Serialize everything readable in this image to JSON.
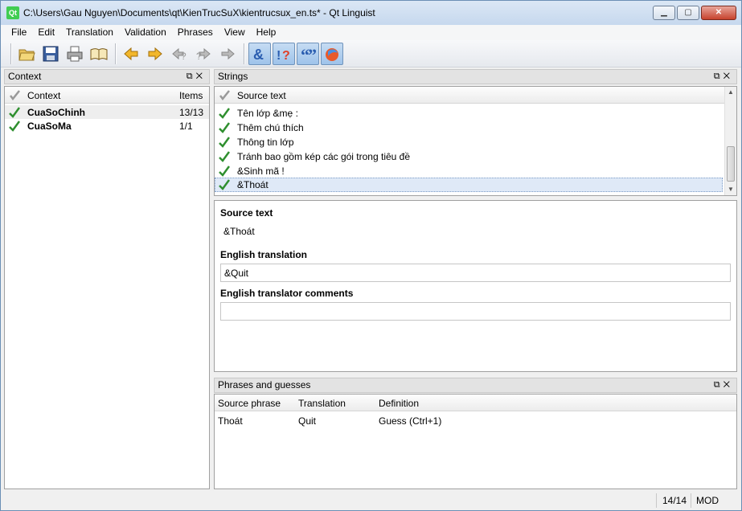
{
  "window": {
    "title": "C:\\Users\\Gau Nguyen\\Documents\\qt\\KienTrucSuX\\kientrucsux_en.ts* - Qt Linguist",
    "app_icon": "Qt"
  },
  "menu": [
    "File",
    "Edit",
    "Translation",
    "Validation",
    "Phrases",
    "View",
    "Help"
  ],
  "toolbar": {
    "icons": [
      "open-icon",
      "save-icon",
      "print-icon",
      "phrasebook-icon",
      "prev-icon",
      "next-icon",
      "prev-unfinished-icon",
      "next-unfinished-icon",
      "done-next-icon",
      "accelerators-icon",
      "punctuation-icon",
      "phrase-matches-icon",
      "placeholder-icon"
    ]
  },
  "context_dock": {
    "title": "Context",
    "columns": {
      "context": "Context",
      "items": "Items"
    },
    "rows": [
      {
        "name": "CuaSoChinh",
        "items": "13/13"
      },
      {
        "name": "CuaSoMa",
        "items": "1/1"
      }
    ]
  },
  "strings_dock": {
    "title": "Strings",
    "column": "Source text",
    "rows": [
      {
        "text": "Tên lớp &mẹ :"
      },
      {
        "text": "Thêm chú thích"
      },
      {
        "text": "Thông tin lớp"
      },
      {
        "text": "Tránh bao gồm kép các gói trong tiêu đề"
      },
      {
        "text": "&Sinh mã !"
      },
      {
        "text": "&Thoát"
      }
    ]
  },
  "editor": {
    "source_label": "Source text",
    "source_value": "&Thoát",
    "translation_label": "English translation",
    "translation_value": "&Quit",
    "comments_label": "English translator comments",
    "comments_value": ""
  },
  "phrases_dock": {
    "title": "Phrases and guesses",
    "columns": {
      "source": "Source phrase",
      "translation": "Translation",
      "definition": "Definition"
    },
    "rows": [
      {
        "source": "Thoát",
        "translation": "Quit",
        "definition": "Guess (Ctrl+1)"
      }
    ]
  },
  "statusbar": {
    "progress": "14/14",
    "mode": "MOD"
  },
  "colors": {
    "check": "#2f8f2f",
    "selection": "#dfe9f7",
    "titlebar": "#c6d8ee"
  }
}
